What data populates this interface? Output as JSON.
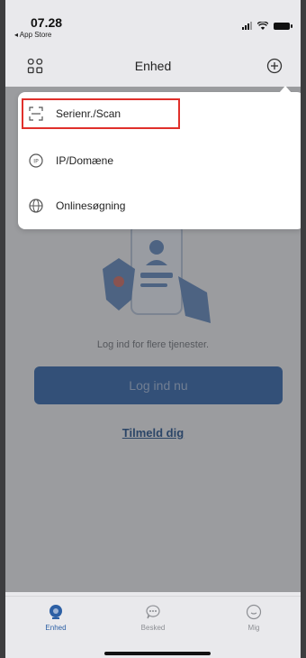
{
  "status": {
    "time": "07.28",
    "back_app": "◂ App Store"
  },
  "nav": {
    "title": "Enhed",
    "left_icon": "device-grid-icon",
    "right_icon": "add-circle-icon"
  },
  "menu": {
    "items": [
      {
        "label": "Serienr./Scan",
        "icon": "scan-icon"
      },
      {
        "label": "IP/Domæne",
        "icon": "ip-icon"
      },
      {
        "label": "Onlinesøgning",
        "icon": "globe-icon"
      }
    ]
  },
  "main": {
    "cta_text": "Log ind for flere tjenester.",
    "login_button": "Log ind nu",
    "signup_link": "Tilmeld dig"
  },
  "tabs": [
    {
      "label": "Enhed",
      "icon": "device-tab-icon",
      "active": true
    },
    {
      "label": "Besked",
      "icon": "message-tab-icon",
      "active": false
    },
    {
      "label": "Mig",
      "icon": "profile-tab-icon",
      "active": false
    }
  ],
  "colors": {
    "accent": "#2c5fa4",
    "highlight": "#e0302b",
    "background": "#e9e9ec"
  }
}
